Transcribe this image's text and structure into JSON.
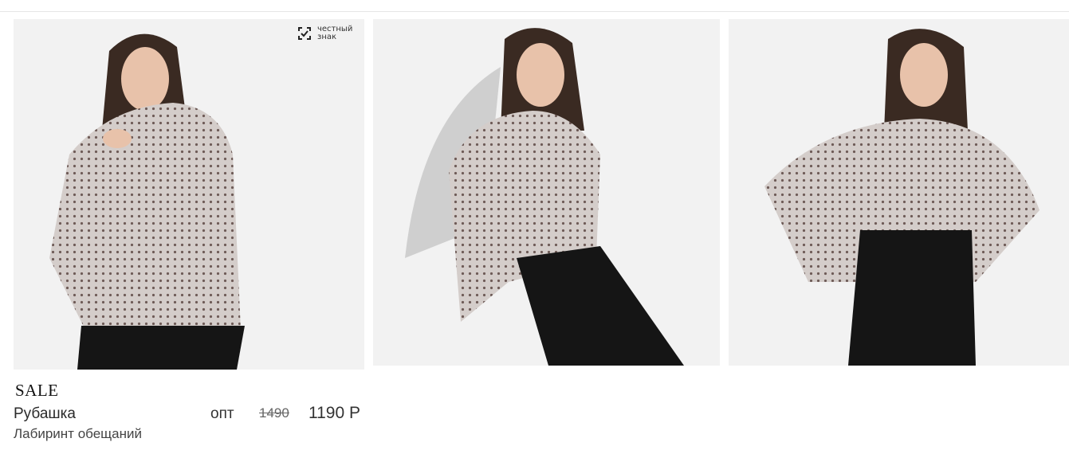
{
  "badge": {
    "icon": "honest-sign-icon",
    "line1": "честный",
    "line2": "знак"
  },
  "product": {
    "badge_sale": "SALE",
    "title": "Рубашка",
    "subtitle": "Лабиринт обещаний",
    "opt_label": "опт",
    "old_price": "1490",
    "price": "1190 Р"
  },
  "images": [
    {
      "alt": "model-photo-front"
    },
    {
      "alt": "model-photo-side"
    },
    {
      "alt": "model-photo-hands-on-hips"
    }
  ],
  "colors": {
    "blouse": "#cfc7c4",
    "pattern": "#6e5b57",
    "pants": "#151515",
    "hair": "#3a2a22",
    "skin": "#e8c2aa",
    "background": "#f2f2f2"
  }
}
